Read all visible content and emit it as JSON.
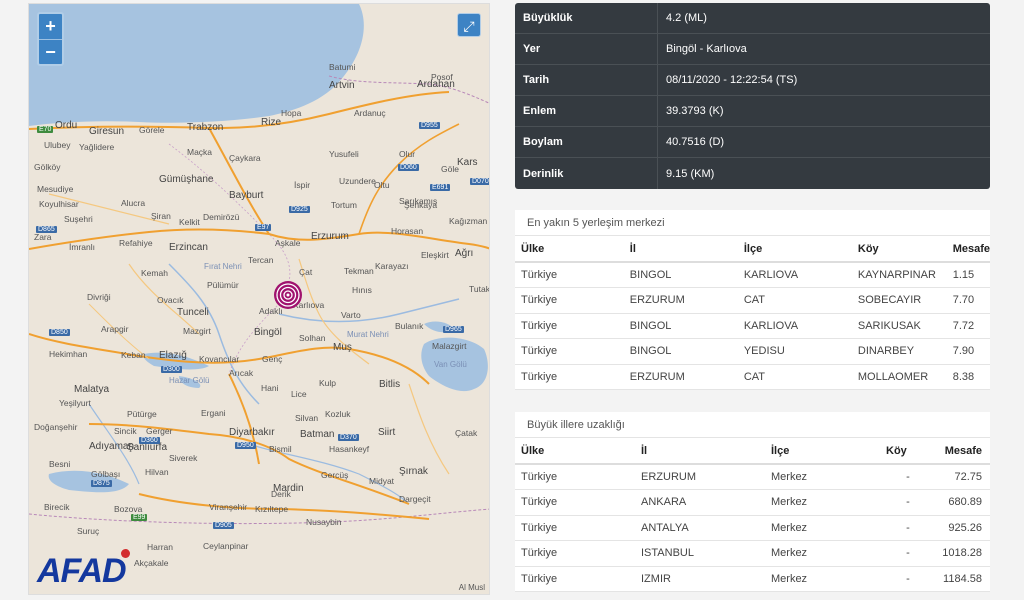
{
  "map": {
    "zoom_in": "+",
    "zoom_out": "−",
    "fullscreen": "⤢",
    "logo": "AFAD",
    "attribution": "Al Musl",
    "place_labels": [
      {
        "t": "Batumi",
        "c": ""
      },
      {
        "t": "Artvin",
        "c": "city"
      },
      {
        "t": "Ardahan",
        "c": "city"
      },
      {
        "t": "Posof",
        "c": ""
      },
      {
        "t": "Ordu",
        "c": "city"
      },
      {
        "t": "Giresun",
        "c": "city"
      },
      {
        "t": "Görele",
        "c": ""
      },
      {
        "t": "Trabzon",
        "c": "city"
      },
      {
        "t": "Rize",
        "c": "city"
      },
      {
        "t": "Hopa",
        "c": ""
      },
      {
        "t": "Ardanuç",
        "c": ""
      },
      {
        "t": "Ulubey",
        "c": ""
      },
      {
        "t": "Yağlidere",
        "c": ""
      },
      {
        "t": "Maçka",
        "c": ""
      },
      {
        "t": "Çaykara",
        "c": ""
      },
      {
        "t": "Yusufeli",
        "c": ""
      },
      {
        "t": "Olur",
        "c": ""
      },
      {
        "t": "Göle",
        "c": ""
      },
      {
        "t": "Kars",
        "c": "city"
      },
      {
        "t": "Gölköy",
        "c": ""
      },
      {
        "t": "Gümüşhane",
        "c": "city"
      },
      {
        "t": "Bayburt",
        "c": "city"
      },
      {
        "t": "İspir",
        "c": ""
      },
      {
        "t": "Uzundere",
        "c": ""
      },
      {
        "t": "Oltu",
        "c": ""
      },
      {
        "t": "Mesudiye",
        "c": ""
      },
      {
        "t": "Koyulhisar",
        "c": ""
      },
      {
        "t": "Alucra",
        "c": ""
      },
      {
        "t": "Şiran",
        "c": ""
      },
      {
        "t": "Kelkit",
        "c": ""
      },
      {
        "t": "Demirözü",
        "c": ""
      },
      {
        "t": "Tortum",
        "c": ""
      },
      {
        "t": "Şenkaya",
        "c": ""
      },
      {
        "t": "Sarıkamış",
        "c": ""
      },
      {
        "t": "Kağızman",
        "c": ""
      },
      {
        "t": "Suşehri",
        "c": ""
      },
      {
        "t": "Zara",
        "c": ""
      },
      {
        "t": "İmranlı",
        "c": ""
      },
      {
        "t": "Refahiye",
        "c": ""
      },
      {
        "t": "Erzincan",
        "c": "city"
      },
      {
        "t": "Aşkale",
        "c": ""
      },
      {
        "t": "Erzurum",
        "c": "city"
      },
      {
        "t": "Horasan",
        "c": ""
      },
      {
        "t": "Ağrı",
        "c": "city"
      },
      {
        "t": "Eleşkirt",
        "c": ""
      },
      {
        "t": "Tercan",
        "c": ""
      },
      {
        "t": "Çat",
        "c": ""
      },
      {
        "t": "Tekman",
        "c": ""
      },
      {
        "t": "Karayazı",
        "c": ""
      },
      {
        "t": "Kemah",
        "c": ""
      },
      {
        "t": "Pülümür",
        "c": ""
      },
      {
        "t": "Hınıs",
        "c": ""
      },
      {
        "t": "Divriği",
        "c": ""
      },
      {
        "t": "Ovacık",
        "c": ""
      },
      {
        "t": "Karlıova",
        "c": ""
      },
      {
        "t": "Adaklı",
        "c": ""
      },
      {
        "t": "Varto",
        "c": ""
      },
      {
        "t": "Tunceli",
        "c": "city"
      },
      {
        "t": "Bulanık",
        "c": ""
      },
      {
        "t": "Arapgir",
        "c": ""
      },
      {
        "t": "Mazgirt",
        "c": ""
      },
      {
        "t": "Bingöl",
        "c": "city"
      },
      {
        "t": "Solhan",
        "c": ""
      },
      {
        "t": "Malazgirt",
        "c": ""
      },
      {
        "t": "Hekimhan",
        "c": ""
      },
      {
        "t": "Keban",
        "c": ""
      },
      {
        "t": "Elazığ",
        "c": "city"
      },
      {
        "t": "Kovancılar",
        "c": ""
      },
      {
        "t": "Genç",
        "c": ""
      },
      {
        "t": "Muş",
        "c": "city"
      },
      {
        "t": "Arıcak",
        "c": ""
      },
      {
        "t": "Malatya",
        "c": "city"
      },
      {
        "t": "Hani",
        "c": ""
      },
      {
        "t": "Lice",
        "c": ""
      },
      {
        "t": "Kulp",
        "c": ""
      },
      {
        "t": "Bitlis",
        "c": "city"
      },
      {
        "t": "Yeşilyurt",
        "c": ""
      },
      {
        "t": "Ergani",
        "c": ""
      },
      {
        "t": "Pütürge",
        "c": ""
      },
      {
        "t": "Silvan",
        "c": ""
      },
      {
        "t": "Kozluk",
        "c": ""
      },
      {
        "t": "Doğanşehir",
        "c": ""
      },
      {
        "t": "Sincik",
        "c": ""
      },
      {
        "t": "Gerger",
        "c": ""
      },
      {
        "t": "Diyarbakır",
        "c": "city"
      },
      {
        "t": "Batman",
        "c": "city"
      },
      {
        "t": "Siirt",
        "c": "city"
      },
      {
        "t": "Çatak",
        "c": ""
      },
      {
        "t": "Adıyaman",
        "c": "city"
      },
      {
        "t": "Bismil",
        "c": ""
      },
      {
        "t": "Hasankeyf",
        "c": ""
      },
      {
        "t": "Besni",
        "c": ""
      },
      {
        "t": "Siverek",
        "c": ""
      },
      {
        "t": "Gercüş",
        "c": ""
      },
      {
        "t": "Şırnak",
        "c": "city"
      },
      {
        "t": "Gölbaşı",
        "c": ""
      },
      {
        "t": "Hilvan",
        "c": ""
      },
      {
        "t": "Midyat",
        "c": ""
      },
      {
        "t": "Derik",
        "c": ""
      },
      {
        "t": "Mardin",
        "c": "city"
      },
      {
        "t": "Şanlıurfa",
        "c": "city"
      },
      {
        "t": "Viranşehir",
        "c": ""
      },
      {
        "t": "Kızıltepe",
        "c": ""
      },
      {
        "t": "Nusaybin",
        "c": ""
      },
      {
        "t": "Harran",
        "c": ""
      },
      {
        "t": "Ceylanpinar",
        "c": ""
      },
      {
        "t": "Akçakale",
        "c": ""
      },
      {
        "t": "Birecik",
        "c": ""
      },
      {
        "t": "Suruç",
        "c": ""
      },
      {
        "t": "Bozova",
        "c": ""
      },
      {
        "t": "Dargeçit",
        "c": ""
      },
      {
        "t": "Tutak",
        "c": ""
      }
    ],
    "road_labels": [
      {
        "t": "E70",
        "c": "rdg"
      },
      {
        "t": "D955",
        "c": "rd"
      },
      {
        "t": "D060",
        "c": "rd"
      },
      {
        "t": "E691",
        "c": "rd"
      },
      {
        "t": "D070",
        "c": "rd"
      },
      {
        "t": "D925",
        "c": "rd"
      },
      {
        "t": "E97",
        "c": "rd"
      },
      {
        "t": "D865",
        "c": "rd"
      },
      {
        "t": "D850",
        "c": "rd"
      },
      {
        "t": "D965",
        "c": "rd"
      },
      {
        "t": "D300",
        "c": "rd"
      },
      {
        "t": "D360",
        "c": "rd"
      },
      {
        "t": "D950",
        "c": "rd"
      },
      {
        "t": "D370",
        "c": "rd"
      },
      {
        "t": "D875",
        "c": "rd"
      },
      {
        "t": "E99",
        "c": "rdg"
      },
      {
        "t": "D905",
        "c": "rd"
      }
    ],
    "water_labels": [
      "Van Gölü",
      "Murat Nehri",
      "Fırat Nehri",
      "Hazar Gölü"
    ]
  },
  "info": {
    "rows": [
      {
        "k": "Büyüklük",
        "v": "4.2 (ML)"
      },
      {
        "k": "Yer",
        "v": "Bingöl - Karlıova"
      },
      {
        "k": "Tarih",
        "v": "08/11/2020 - 12:22:54 (TS)"
      },
      {
        "k": "Enlem",
        "v": "39.3793 (K)"
      },
      {
        "k": "Boylam",
        "v": "40.7516 (D)"
      },
      {
        "k": "Derinlik",
        "v": "9.15 (KM)"
      }
    ]
  },
  "nearest": {
    "caption": "En yakın 5 yerleşim merkezi",
    "headers": [
      "Ülke",
      "İl",
      "İlçe",
      "Köy",
      "Mesafe"
    ],
    "rows": [
      [
        "Türkiye",
        "BINGOL",
        "KARLIOVA",
        "KAYNARPINAR",
        "1.15"
      ],
      [
        "Türkiye",
        "ERZURUM",
        "CAT",
        "SOBECAYIR",
        "7.70"
      ],
      [
        "Türkiye",
        "BINGOL",
        "KARLIOVA",
        "SARIKUSAK",
        "7.72"
      ],
      [
        "Türkiye",
        "BINGOL",
        "YEDISU",
        "DINARBEY",
        "7.90"
      ],
      [
        "Türkiye",
        "ERZURUM",
        "CAT",
        "MOLLAOMER",
        "8.38"
      ]
    ]
  },
  "cities": {
    "caption": "Büyük illere uzaklığı",
    "headers": [
      "Ülke",
      "İl",
      "İlçe",
      "Köy",
      "Mesafe"
    ],
    "rows": [
      [
        "Türkiye",
        "ERZURUM",
        "Merkez",
        "-",
        "72.75"
      ],
      [
        "Türkiye",
        "ANKARA",
        "Merkez",
        "-",
        "680.89"
      ],
      [
        "Türkiye",
        "ANTALYA",
        "Merkez",
        "-",
        "925.26"
      ],
      [
        "Türkiye",
        "ISTANBUL",
        "Merkez",
        "-",
        "1018.28"
      ],
      [
        "Türkiye",
        "IZMIR",
        "Merkez",
        "-",
        "1184.58"
      ]
    ]
  },
  "colors": {
    "header_bg": "#343a40",
    "map_land": "#ece5da",
    "water": "#a6c3e0",
    "accent": "#3d83c4",
    "quake": "#a0126e"
  }
}
